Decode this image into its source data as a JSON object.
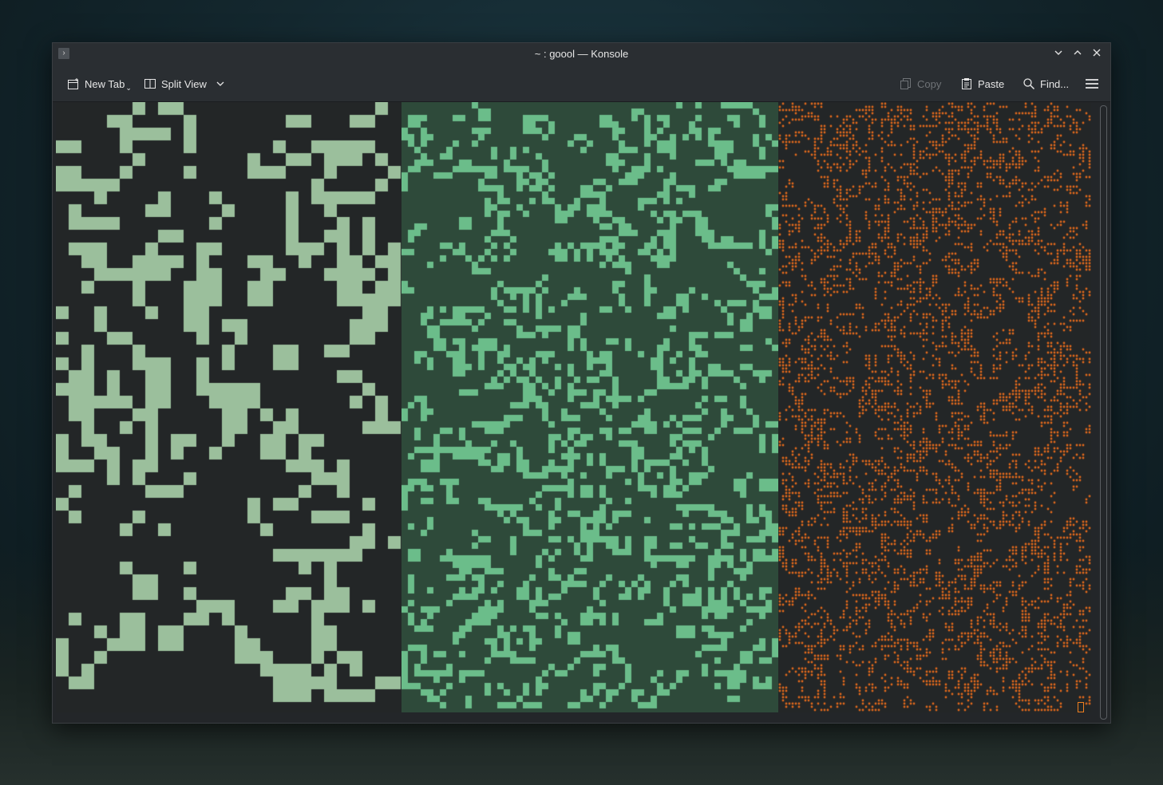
{
  "window": {
    "title": "~ : goool — Konsole",
    "buttons": {
      "minimize": "minimize-icon",
      "maximize": "maximize-icon",
      "close": "close-icon"
    }
  },
  "toolbar": {
    "new_tab_label": "New Tab",
    "split_view_label": "Split View",
    "copy_label": "Copy",
    "paste_label": "Paste",
    "find_label": "Find..."
  },
  "panes": {
    "left": {
      "cell_color": "#9bbf9c",
      "background": "#232627",
      "seed": 7
    },
    "middle": {
      "cell_color": "#6bbd8a",
      "background": "#2e4a3a",
      "seed": 23
    },
    "right": {
      "cell_color": "#e0691c",
      "background": "#232627",
      "seed": 91
    }
  }
}
